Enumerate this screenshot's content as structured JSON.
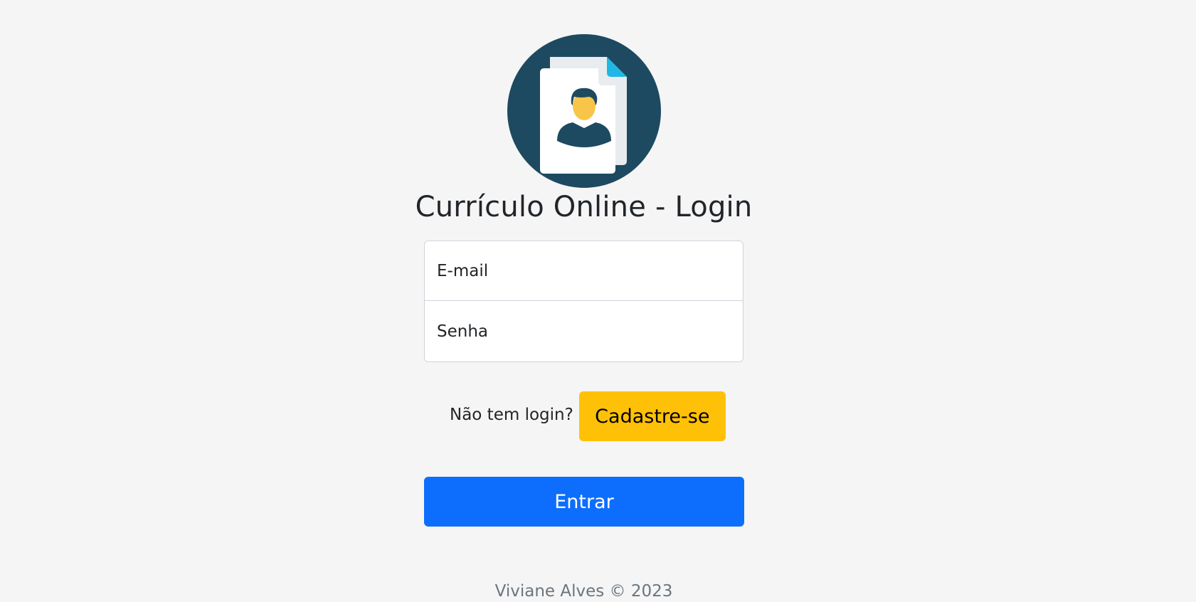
{
  "page": {
    "title": "Currículo Online - Login"
  },
  "logo": {
    "icon": "resume-document-icon",
    "colors": {
      "circle": "#1d4a61",
      "page": "#ffffff",
      "back_page": "#e8ecef",
      "fold": "#1fb8e6",
      "face": "#f9c548",
      "hair": "#1d4a61"
    }
  },
  "form": {
    "email_placeholder": "E-mail",
    "password_placeholder": "Senha"
  },
  "signup": {
    "prompt": "Não tem login?",
    "button_label": "Cadastre-se"
  },
  "submit": {
    "button_label": "Entrar"
  },
  "footer": {
    "text": "Viviane Alves © 2023"
  },
  "colors": {
    "background": "#f5f5f5",
    "primary": "#0d6efd",
    "warning": "#ffc107",
    "muted": "#6c757d"
  }
}
